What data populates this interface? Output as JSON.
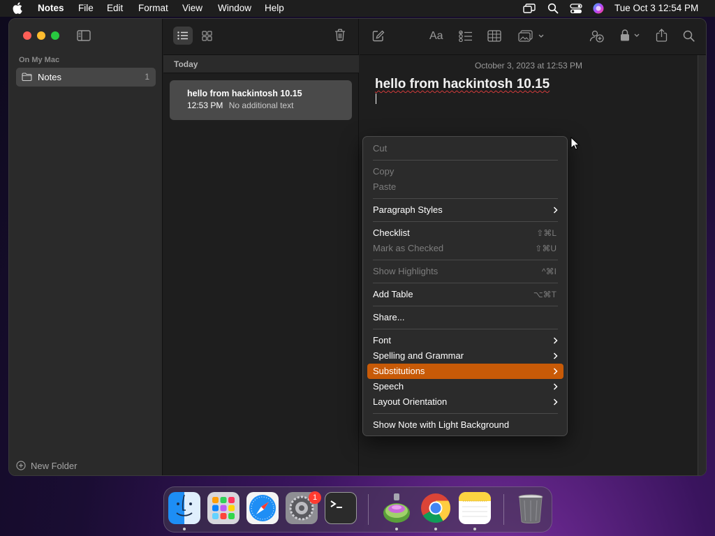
{
  "menubar": {
    "app_name": "Notes",
    "menus": [
      "File",
      "Edit",
      "Format",
      "View",
      "Window",
      "Help"
    ],
    "clock": "Tue Oct 3  12:54 PM"
  },
  "sidebar": {
    "section_label": "On My Mac",
    "folder": {
      "label": "Notes",
      "count": "1"
    },
    "new_folder_label": "New Folder"
  },
  "notelist": {
    "group_label": "Today",
    "note": {
      "title": "hello from hackintosh 10.15",
      "time": "12:53 PM",
      "preview": "No additional text"
    }
  },
  "editor": {
    "date": "October 3, 2023 at 12:53 PM",
    "title": "hello from hackintosh 10.15"
  },
  "context_menu": {
    "cut": "Cut",
    "copy": "Copy",
    "paste": "Paste",
    "paragraph_styles": "Paragraph Styles",
    "checklist": "Checklist",
    "checklist_shortcut": "⇧⌘L",
    "mark_checked": "Mark as Checked",
    "mark_checked_shortcut": "⇧⌘U",
    "show_highlights": "Show Highlights",
    "show_highlights_shortcut": "^⌘I",
    "add_table": "Add Table",
    "add_table_shortcut": "⌥⌘T",
    "share": "Share...",
    "font": "Font",
    "spelling": "Spelling and Grammar",
    "substitutions": "Substitutions",
    "speech": "Speech",
    "layout_orientation": "Layout Orientation",
    "light_background": "Show Note with Light Background"
  },
  "dock": {
    "settings_badge": "1",
    "apps": [
      "finder-icon",
      "launchpad-icon",
      "safari-icon",
      "system-preferences-icon",
      "terminal-icon",
      "disk-utility-icon",
      "chrome-icon",
      "notes-app-icon",
      "trash-icon"
    ]
  },
  "colors": {
    "accent_highlight": "#c85a07",
    "close": "#ff5f57",
    "minimize": "#febc2e",
    "zoom": "#28c840"
  }
}
